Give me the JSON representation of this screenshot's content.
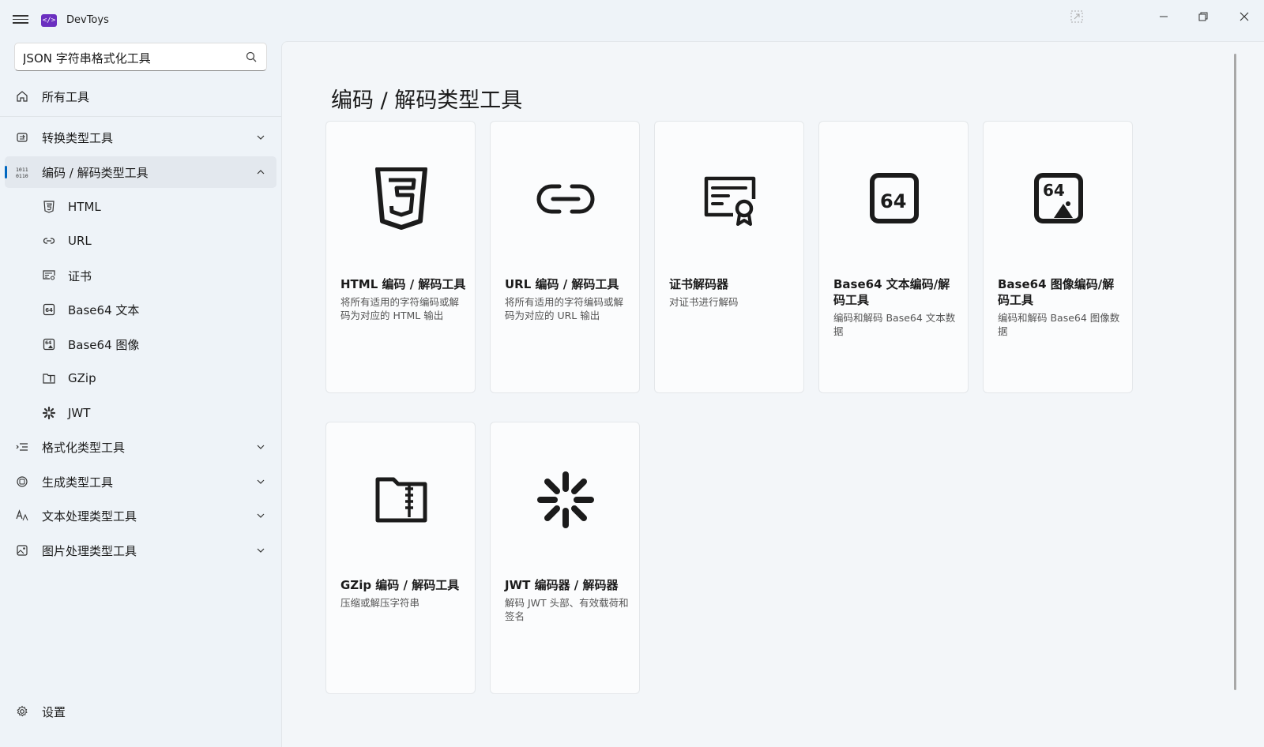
{
  "app": {
    "title": "DevToys"
  },
  "search": {
    "value": "JSON 字符串格式化工具"
  },
  "sidebar": {
    "all_tools": "所有工具",
    "categories": [
      {
        "label": "转换类型工具",
        "expanded": false
      },
      {
        "label": "编码 / 解码类型工具",
        "expanded": true,
        "selected": true
      },
      {
        "label": "格式化类型工具",
        "expanded": false
      },
      {
        "label": "生成类型工具",
        "expanded": false
      },
      {
        "label": "文本处理类型工具",
        "expanded": false
      },
      {
        "label": "图片处理类型工具",
        "expanded": false
      }
    ],
    "sub_items": [
      {
        "label": "HTML",
        "icon": "html5-icon"
      },
      {
        "label": "URL",
        "icon": "link-icon"
      },
      {
        "label": "证书",
        "icon": "certificate-icon"
      },
      {
        "label": "Base64 文本",
        "icon": "base64-text-icon"
      },
      {
        "label": "Base64 图像",
        "icon": "base64-image-icon"
      },
      {
        "label": "GZip",
        "icon": "gzip-icon"
      },
      {
        "label": "JWT",
        "icon": "jwt-icon"
      }
    ],
    "settings": "设置"
  },
  "main": {
    "title": "编码 / 解码类型工具",
    "cards": [
      {
        "title": "HTML 编码 / 解码工具",
        "desc": "将所有适用的字符编码或解码为对应的 HTML 输出",
        "icon": "html5-icon"
      },
      {
        "title": "URL 编码 / 解码工具",
        "desc": "将所有适用的字符编码或解码为对应的 URL 输出",
        "icon": "link-icon"
      },
      {
        "title": "证书解码器",
        "desc": "对证书进行解码",
        "icon": "certificate-icon"
      },
      {
        "title": "Base64 文本编码/解码工具",
        "desc": "编码和解码 Base64 文本数据",
        "icon": "base64-text-icon"
      },
      {
        "title": "Base64 图像编码/解码工具",
        "desc": "编码和解码 Base64 图像数据",
        "icon": "base64-image-icon"
      },
      {
        "title": "GZip 编码 / 解码工具",
        "desc": "压缩或解压字符串",
        "icon": "gzip-icon"
      },
      {
        "title": "JWT 编码器 / 解码器",
        "desc": "解码 JWT 头部、有效载荷和签名",
        "icon": "jwt-icon"
      }
    ]
  },
  "colors": {
    "accent": "#0067c0",
    "app_icon": "#6b2fc0"
  }
}
